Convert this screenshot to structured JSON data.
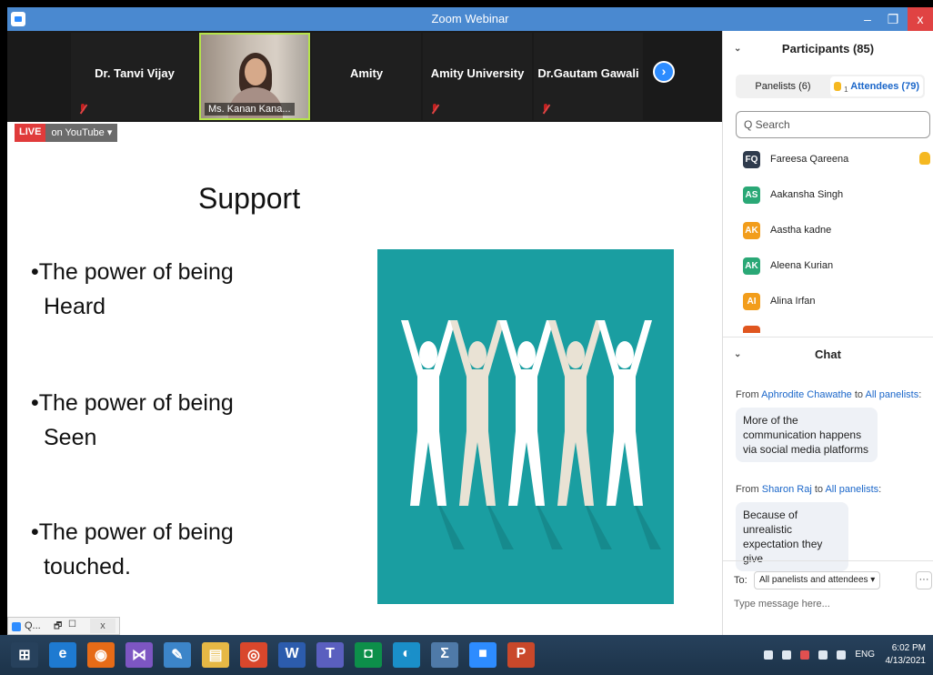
{
  "window": {
    "title": "Zoom Webinar",
    "close_glyph": "x",
    "max_glyph": "❐",
    "min_glyph": "–"
  },
  "video_strip": {
    "tiles": [
      {
        "name": "Dr. Tanvi Vijay"
      },
      {
        "name": "Ms. Kanan Kana...",
        "has_video": true
      },
      {
        "name": "Amity"
      },
      {
        "name": "Amity University"
      },
      {
        "name": "Dr.Gautam Gawali"
      }
    ],
    "next_glyph": "›"
  },
  "live": {
    "badge": "LIVE",
    "platform": "on YouTube ▾"
  },
  "slide": {
    "title": "Support",
    "bullets": [
      {
        "line1": "•The power of being",
        "line2": "Heard"
      },
      {
        "line1": "•The power of being",
        "line2": "Seen"
      },
      {
        "line1": "•The power of being",
        "line2": "touched."
      }
    ],
    "image_bg": "#1a9ea1",
    "figure_colors": [
      "#ffffff",
      "#e9e2d4",
      "#ffffff",
      "#e9e2d4",
      "#ffffff"
    ]
  },
  "minimized": {
    "label": "Q...",
    "close": "x"
  },
  "participants": {
    "header": "Participants (85)",
    "tabs": {
      "panelists": "Panelists (6)",
      "attendees": "Attendees (79)",
      "raised_count": "1"
    },
    "search_placeholder": "Q Search",
    "list": [
      {
        "initials": "FQ",
        "name": "Fareesa Qareena",
        "color": "#2f3b4d",
        "hand_raised": true
      },
      {
        "initials": "AS",
        "name": "Aakansha Singh",
        "color": "#2aa876"
      },
      {
        "initials": "AK",
        "name": "Aastha kadne",
        "color": "#f29d1b"
      },
      {
        "initials": "AK",
        "name": "Aleena Kurian",
        "color": "#2aa876"
      },
      {
        "initials": "AI",
        "name": "Alina Irfan",
        "color": "#f29d1b"
      }
    ]
  },
  "chat": {
    "header": "Chat",
    "messages": [
      {
        "from_prefix": "From ",
        "from": "Aphrodite Chawathe",
        "to_prefix": " to ",
        "to": "All panelists",
        "to_suffix": ":",
        "text": "More of the communication happens via social media platforms"
      },
      {
        "from_prefix": "From ",
        "from": "Sharon Raj",
        "to_prefix": " to ",
        "to": "All panelists",
        "to_suffix": ":",
        "text": "Because of unrealistic expectation they give"
      }
    ],
    "to_label": "To:",
    "to_value": "All panelists and attendees ▾",
    "more": "···",
    "input_placeholder": "Type message here..."
  },
  "taskbar": {
    "apps": [
      {
        "name": "windows-start-icon",
        "glyph": "⊞",
        "color": "#27415c"
      },
      {
        "name": "internet-explorer-icon",
        "glyph": "e",
        "color": "#1e7ad1"
      },
      {
        "name": "firefox-icon",
        "glyph": "◉",
        "color": "#e66b17"
      },
      {
        "name": "visual-studio-icon",
        "glyph": "⋈",
        "color": "#7d56c2"
      },
      {
        "name": "paint-icon",
        "glyph": "✎",
        "color": "#3c85c9"
      },
      {
        "name": "file-explorer-icon",
        "glyph": "▤",
        "color": "#e6b845"
      },
      {
        "name": "chrome-icon",
        "glyph": "◎",
        "color": "#d9472c"
      },
      {
        "name": "word-icon",
        "glyph": "W",
        "color": "#2c5cad"
      },
      {
        "name": "teams-icon",
        "glyph": "T",
        "color": "#5a5fbf"
      },
      {
        "name": "store-icon",
        "glyph": "◘",
        "color": "#0d8f4a"
      },
      {
        "name": "edge-icon",
        "glyph": "◐",
        "color": "#1a8fc9"
      },
      {
        "name": "calculator-icon",
        "glyph": "Σ",
        "color": "#4f7aa8"
      },
      {
        "name": "zoom-icon",
        "glyph": "■",
        "color": "#2d8cff"
      },
      {
        "name": "powerpoint-icon",
        "glyph": "P",
        "color": "#c9482a"
      }
    ],
    "language": "ENG",
    "time": "6:02 PM",
    "date": "4/13/2021"
  }
}
